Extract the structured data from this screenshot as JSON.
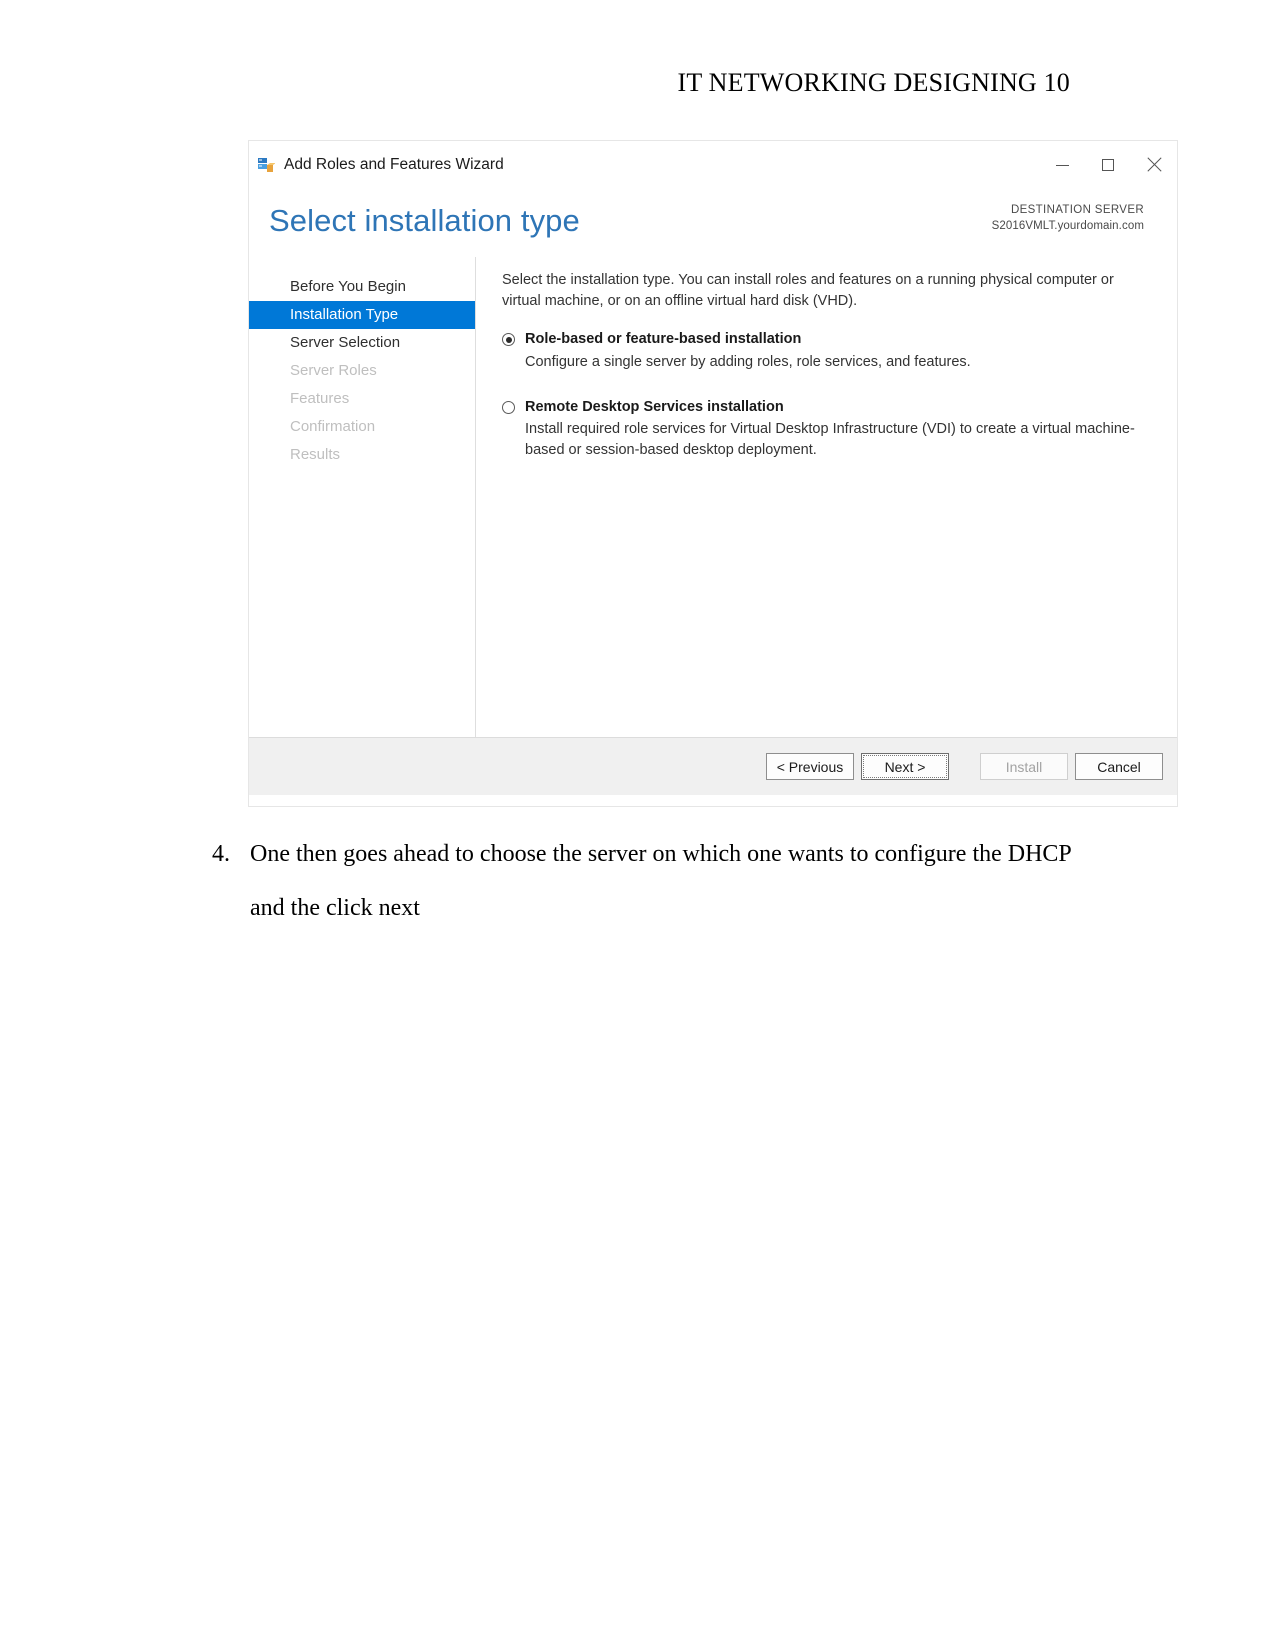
{
  "document": {
    "header": "IT NETWORKING DESIGNING 10",
    "list_items": [
      {
        "number": "4.",
        "line1": "One then goes ahead to choose the server on which one wants to configure the DHCP",
        "line2": "and the click next"
      }
    ]
  },
  "wizard": {
    "titlebar": {
      "title": "Add Roles and Features Wizard",
      "minimize_label": "Minimize",
      "maximize_label": "Maximize",
      "close_label": "Close"
    },
    "header": {
      "page_title": "Select installation type",
      "destination_label": "DESTINATION SERVER",
      "destination_server": "S2016VMLT.yourdomain.com"
    },
    "nav": {
      "items": [
        {
          "label": "Before You Begin",
          "state": "enabled"
        },
        {
          "label": "Installation Type",
          "state": "selected"
        },
        {
          "label": "Server Selection",
          "state": "enabled"
        },
        {
          "label": "Server Roles",
          "state": "disabled"
        },
        {
          "label": "Features",
          "state": "disabled"
        },
        {
          "label": "Confirmation",
          "state": "disabled"
        },
        {
          "label": "Results",
          "state": "disabled"
        }
      ]
    },
    "content": {
      "intro": "Select the installation type. You can install roles and features on a running physical computer or virtual machine, or on an offline virtual hard disk (VHD).",
      "options": [
        {
          "label": "Role-based or feature-based installation",
          "description": "Configure a single server by adding roles, role services, and features.",
          "selected": true
        },
        {
          "label": "Remote Desktop Services installation",
          "description": "Install required role services for Virtual Desktop Infrastructure (VDI) to create a virtual machine-based or session-based desktop deployment.",
          "selected": false
        }
      ]
    },
    "footer": {
      "previous": "< Previous",
      "next": "Next >",
      "install": "Install",
      "cancel": "Cancel"
    },
    "colors": {
      "accent": "#0078d7",
      "title_blue": "#2e75b6",
      "footer_bg": "#f0f0f0"
    }
  }
}
